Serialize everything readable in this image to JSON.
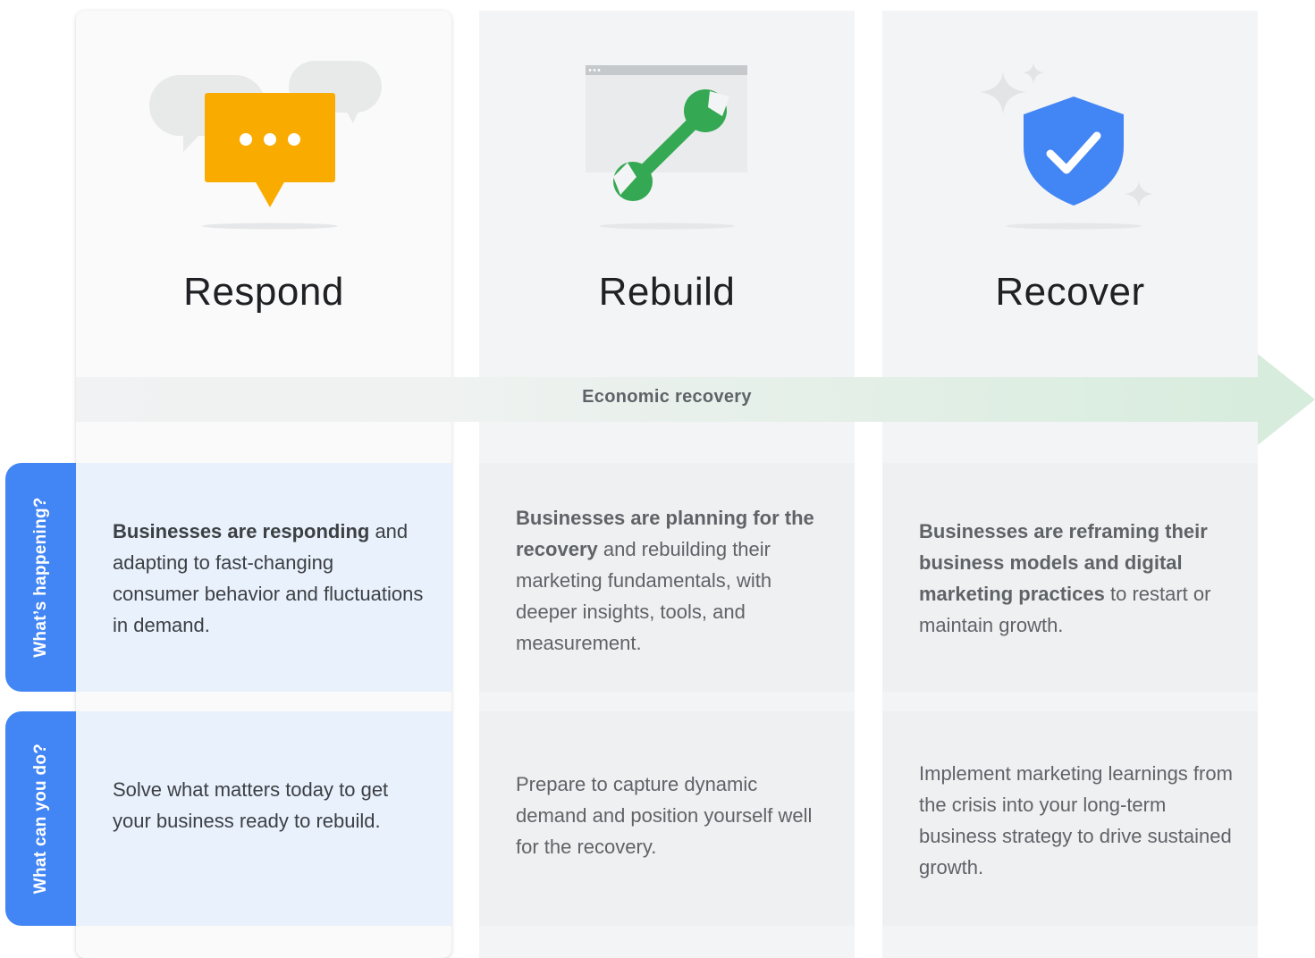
{
  "stages": [
    {
      "title": "Respond",
      "icon": "chat-bubble-icon"
    },
    {
      "title": "Rebuild",
      "icon": "wrench-icon"
    },
    {
      "title": "Recover",
      "icon": "shield-check-icon"
    }
  ],
  "arrow": {
    "label": "Economic recovery"
  },
  "rows": [
    {
      "label": "What’s happening?",
      "cells": [
        {
          "bold": "Businesses are responding",
          "rest": " and adapting to fast-changing consumer behavior and fluctuations in demand."
        },
        {
          "bold": "Businesses are planning for the recovery",
          "rest": " and rebuilding their marketing fundamentals, with deeper insights, tools, and measurement."
        },
        {
          "bold": "Businesses are reframing their business models and digital marketing practices",
          "rest": " to restart or maintain growth."
        }
      ]
    },
    {
      "label": "What can you do?",
      "cells": [
        {
          "text": "Solve what matters today to get your business ready to rebuild."
        },
        {
          "text": "Prepare to capture dynamic demand and position yourself well for the recovery."
        },
        {
          "text": "Implement marketing learnings from the crisis into your long-term business strategy to drive sustained growth."
        }
      ]
    }
  ],
  "colors": {
    "blue": "#4285f4",
    "yellow": "#f9ab00",
    "green": "#34a853",
    "arrow_green": "#d6ecdc",
    "highlight": "#e9f1fd"
  }
}
